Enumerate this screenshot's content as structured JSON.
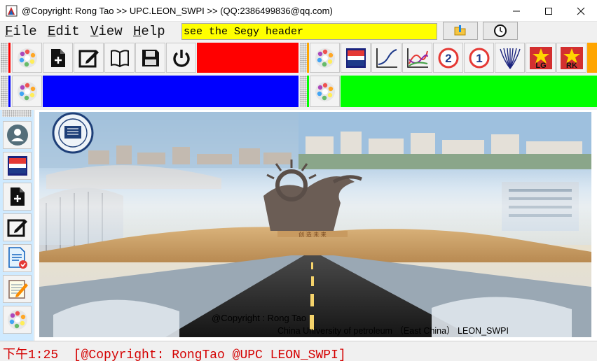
{
  "window": {
    "title": "@Copyright: Rong Tao >> UPC.LEON_SWPI >> (QQ:2386499836@qq.com)",
    "minimize_glyph": "—",
    "maximize_glyph": "☐",
    "close_glyph": "✕"
  },
  "menu": {
    "items": [
      {
        "accel": "F",
        "rest": "ile"
      },
      {
        "accel": "E",
        "rest": "dit"
      },
      {
        "accel": "V",
        "rest": "iew"
      },
      {
        "accel": "H",
        "rest": "elp"
      }
    ],
    "hint_text": "see the Segy header"
  },
  "toolbar_colors": {
    "red": "#ff0000",
    "blue": "#0000ff",
    "green": "#00ff00",
    "orange": "#ffa500",
    "status_text": "#d40000"
  },
  "toolbar1": {
    "icons": [
      "palette-icon",
      "new-file-icon",
      "edit-icon",
      "open-book-icon",
      "save-icon",
      "power-icon"
    ]
  },
  "toolbar2": {
    "icons": [
      "palette-icon",
      "flag-icon",
      "curve-icon",
      "multi-curve-icon",
      "number-2-icon",
      "number-1-icon",
      "fan-icon",
      "lg-icon",
      "rk-icon"
    ],
    "lg_label": "LG",
    "rk_label": "RK",
    "num2_label": "2",
    "num1_label": "1"
  },
  "side_toolbar": {
    "icons": [
      "user-icon",
      "flag-icon",
      "new-file-icon",
      "edit-icon",
      "document-icon",
      "notepad-icon",
      "palette-icon"
    ]
  },
  "image": {
    "caption_line1": "@Copyright : Rong Tao",
    "caption_line2": "China University of petroleum （East China） LEON_SWPI",
    "monument_text": "创 造 未 来"
  },
  "status": {
    "text": "下午1:25  [@Copyright: RongTao @UPC LEON_SWPI]"
  }
}
